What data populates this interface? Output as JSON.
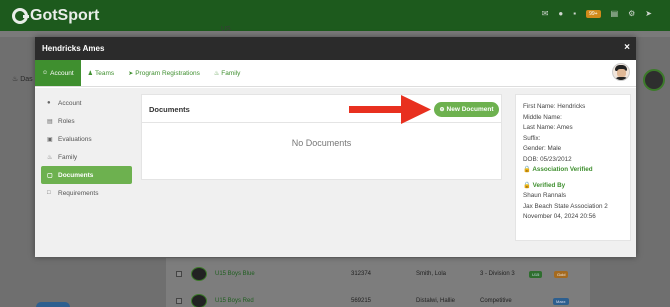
{
  "background": {
    "logo_text": "GotSport",
    "badge": "99+",
    "us_text": "US",
    "left_text": "Das",
    "rows": [
      {
        "team": "U15 Boys Blue",
        "number": "312374",
        "name": "Smith, Lola",
        "division": "3 - Division 3",
        "tag1": "U15",
        "tag2": "Gold"
      },
      {
        "team": "U15 Boys Red",
        "number": "569215",
        "name": "Distalwi, Hallie",
        "division": "Competitive",
        "tag3": "Maxx"
      }
    ]
  },
  "modal": {
    "title": "Hendricks Ames",
    "close_label": "×",
    "tabs": [
      {
        "label": "Account",
        "icon": "account-icon"
      },
      {
        "label": "Teams",
        "icon": "teams-icon"
      },
      {
        "label": "Program Registrations",
        "icon": "paper-plane-icon"
      },
      {
        "label": "Family",
        "icon": "family-icon"
      }
    ],
    "sidenav": [
      {
        "label": "Account",
        "icon": "user-icon"
      },
      {
        "label": "Roles",
        "icon": "id-card-icon"
      },
      {
        "label": "Evaluations",
        "icon": "calendar-icon"
      },
      {
        "label": "Family",
        "icon": "family-icon"
      },
      {
        "label": "Documents",
        "icon": "folder-icon"
      },
      {
        "label": "Requirements",
        "icon": "file-icon"
      }
    ],
    "documents": {
      "title": "Documents",
      "new_button": "New Document",
      "empty_text": "No Documents"
    },
    "info": {
      "first_name": "First Name: Hendricks",
      "middle_name": "Middle Name:",
      "last_name": "Last Name: Ames",
      "suffix": "Suffix:",
      "gender": "Gender: Male",
      "dob": "DOB: 05/23/2012",
      "association_verified": "Association Verified",
      "verified_by": "Verified By",
      "verifier_name": "Shaun Rannals",
      "verifier_org": "Jax Beach State Association 2",
      "verified_date": "November 04, 2024 20:56"
    }
  },
  "colors": {
    "accent": "#6db14f",
    "tab_active": "#3f8f2f",
    "header": "#2b2b2b",
    "arrow": "#e8301f"
  }
}
